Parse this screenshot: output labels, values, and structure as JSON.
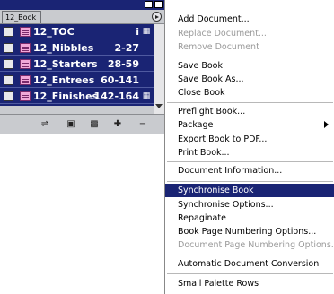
{
  "palette": {
    "tab_label": "12_Book",
    "documents": [
      {
        "name": "12_TOC",
        "pages": "i",
        "status": "open-icon"
      },
      {
        "name": "12_Nibbles",
        "pages": "2-27",
        "status": ""
      },
      {
        "name": "12_Starters",
        "pages": "28-59",
        "status": ""
      },
      {
        "name": "12_Entrees",
        "pages": "60-141",
        "status": ""
      },
      {
        "name": "12_Finishes",
        "pages": "142-164",
        "status": "open-icon"
      }
    ],
    "toolbar": [
      "sync-icon",
      "save-icon",
      "print-icon",
      "add-icon",
      "remove-icon"
    ]
  },
  "menu": {
    "items": [
      {
        "label": "Add Document...",
        "disabled": false
      },
      {
        "label": "Replace Document...",
        "disabled": true
      },
      {
        "label": "Remove Document",
        "disabled": true
      },
      {
        "label": "Save Book",
        "disabled": false
      },
      {
        "label": "Save Book As...",
        "disabled": false
      },
      {
        "label": "Close Book",
        "disabled": false
      },
      {
        "label": "Preflight Book...",
        "disabled": false
      },
      {
        "label": "Package",
        "disabled": false,
        "submenu": true
      },
      {
        "label": "Export Book to PDF...",
        "disabled": false
      },
      {
        "label": "Print Book...",
        "disabled": false
      },
      {
        "label": "Document Information...",
        "disabled": false
      },
      {
        "label": "Synchronise Book",
        "disabled": false,
        "selected": true
      },
      {
        "label": "Synchronise Options...",
        "disabled": false
      },
      {
        "label": "Repaginate",
        "disabled": false
      },
      {
        "label": "Book Page Numbering Options...",
        "disabled": false
      },
      {
        "label": "Document Page Numbering Options...",
        "disabled": true
      },
      {
        "label": "Automatic Document Conversion",
        "disabled": false
      },
      {
        "label": "Small Palette Rows",
        "disabled": false
      }
    ]
  },
  "colors": {
    "selection": "#1a2474",
    "palette_bg": "#c9cbcf"
  }
}
